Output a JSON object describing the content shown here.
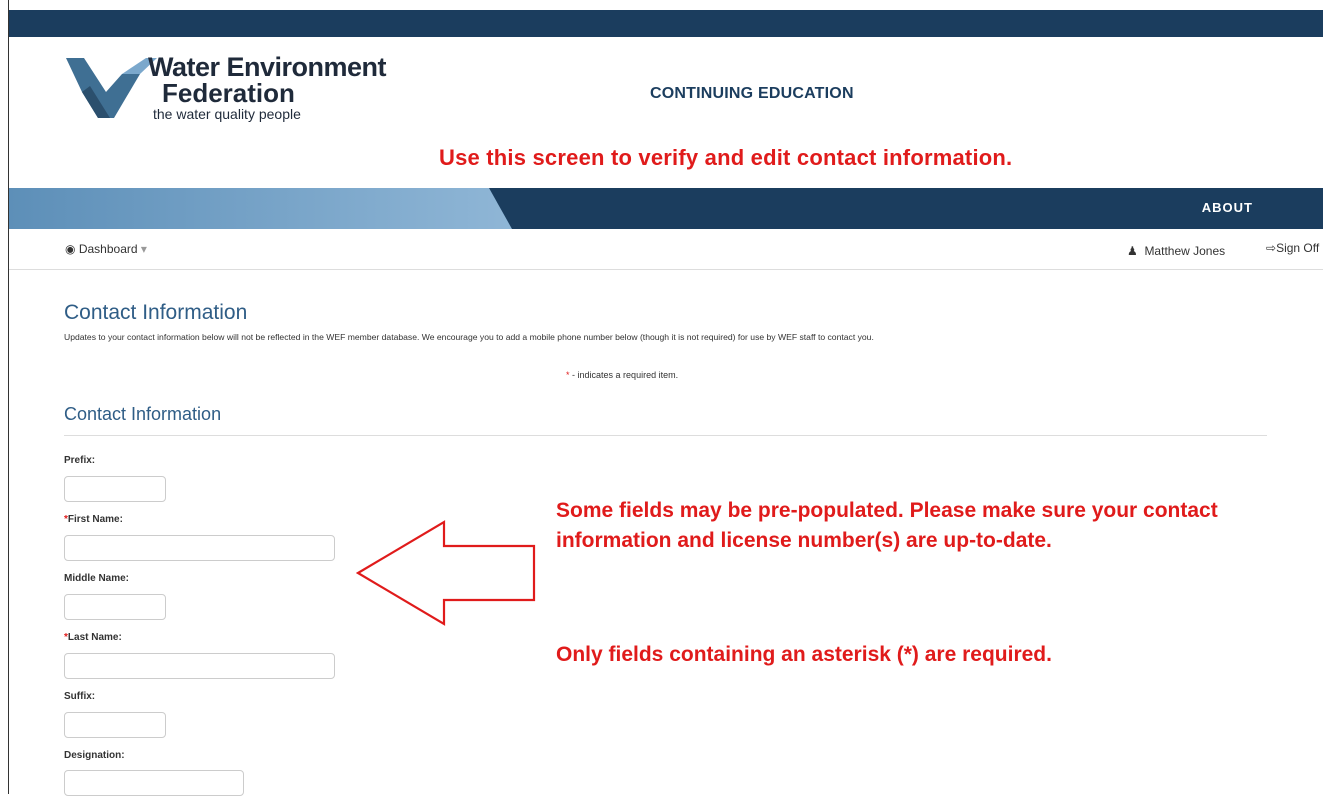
{
  "header": {
    "logo_title": "Water Environment",
    "logo_subtitle": "Federation",
    "logo_tagline": "the water quality people",
    "section_title": "CONTINUING EDUCATION"
  },
  "annotations": {
    "top": "Use this screen to verify and edit contact information.",
    "middle": "Some fields may be pre-populated. Please make sure your contact information and license number(s) are up-to-date.",
    "bottom": "Only fields containing an asterisk (*) are required."
  },
  "nav": {
    "about": "ABOUT"
  },
  "subnav": {
    "dashboard": "Dashboard",
    "user_name": "Matthew Jones",
    "sign_off": "Sign Off"
  },
  "content": {
    "title": "Contact Information",
    "intro": "Updates to your contact information below will not be reflected in the WEF member database. We encourage you to add a mobile phone number below (though it is not required) for use by WEF staff to contact you.",
    "required_note": "- indicates a required item.",
    "section_title": "Contact Information"
  },
  "form": {
    "prefix": {
      "label": "Prefix:",
      "value": ""
    },
    "first_name": {
      "label": "First Name:",
      "value": ""
    },
    "middle_name": {
      "label": "Middle Name:",
      "value": ""
    },
    "last_name": {
      "label": "Last Name:",
      "value": ""
    },
    "suffix": {
      "label": "Suffix:",
      "value": ""
    },
    "designation": {
      "label": "Designation:",
      "value": ""
    }
  },
  "colors": {
    "navy": "#1b3d5e",
    "light_blue": "#7ba8cc",
    "annotation_red": "#e01b1b",
    "heading_blue": "#2f5d86"
  }
}
